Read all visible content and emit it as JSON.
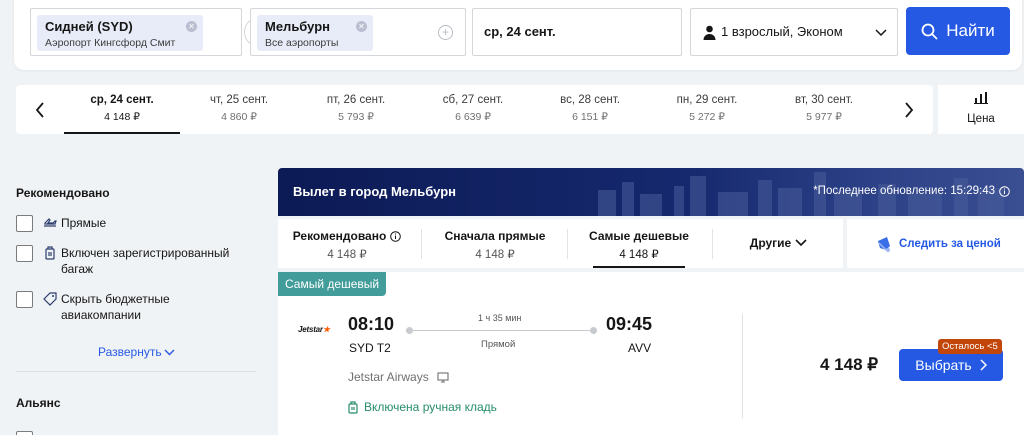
{
  "search": {
    "origin_city": "Сидней (SYD)",
    "origin_airport": "Аэропорт Кингсфорд Смит",
    "destination_city": "Мельбурн",
    "destination_airport": "Все аэропорты",
    "date": "ср, 24 сент.",
    "passengers": "1 взрослый, Эконом",
    "find_label": "Найти"
  },
  "dates": [
    {
      "label": "ср, 24 сент.",
      "price": "4 148 ₽",
      "active": true
    },
    {
      "label": "чт, 25 сент.",
      "price": "4 860 ₽"
    },
    {
      "label": "пт, 26 сент.",
      "price": "5 793 ₽"
    },
    {
      "label": "сб, 27 сент.",
      "price": "6 639 ₽"
    },
    {
      "label": "вс, 28 сент.",
      "price": "6 151 ₽"
    },
    {
      "label": "пн, 29 сент.",
      "price": "5 272 ₽"
    },
    {
      "label": "вт, 30 сент.",
      "price": "5 977 ₽"
    }
  ],
  "price_toggle_label": "Цена",
  "filters": {
    "recommended_heading": "Рекомендовано",
    "items": [
      {
        "label": "Прямые",
        "icon": "direct-flight-icon"
      },
      {
        "label": "Включен зарегистрированный багаж",
        "icon": "checked-baggage-icon"
      },
      {
        "label": "Скрыть бюджетные авиакомпании",
        "icon": "tag-icon"
      }
    ],
    "expand_label": "Развернуть",
    "alliance_heading": "Альянс"
  },
  "banner": {
    "title": "Вылет в город Мельбурн",
    "updated": "*Последнее обновление: 15:29:43"
  },
  "sort_tabs": [
    {
      "label": "Рекомендовано",
      "price": "4 148 ₽"
    },
    {
      "label": "Сначала прямые",
      "price": "4 148 ₽"
    },
    {
      "label": "Самые дешевые",
      "price": "4 148 ₽",
      "active": true
    },
    {
      "label": "Другие",
      "price": ""
    }
  ],
  "watch_price_label": "Следить за ценой",
  "ticket": {
    "badge": "Самый дешевый",
    "airline_logo_text": "Jetstar",
    "dep_time": "08:10",
    "dep_code": "SYD T2",
    "arr_time": "09:45",
    "arr_code": "AVV",
    "duration": "1 ч 35 мин",
    "type": "Прямой",
    "airline": "Jetstar Airways",
    "baggage": "Включена ручная кладь",
    "price": "4 148 ₽",
    "select_label": "Выбрать",
    "seats_left": "Осталось <5"
  },
  "colors": {
    "accent": "#2559e4",
    "cheap_badge": "#419c9a",
    "seats_badge": "#c2460a",
    "baggage_green": "#278e6b",
    "banner_dark": "#0c1a55"
  }
}
